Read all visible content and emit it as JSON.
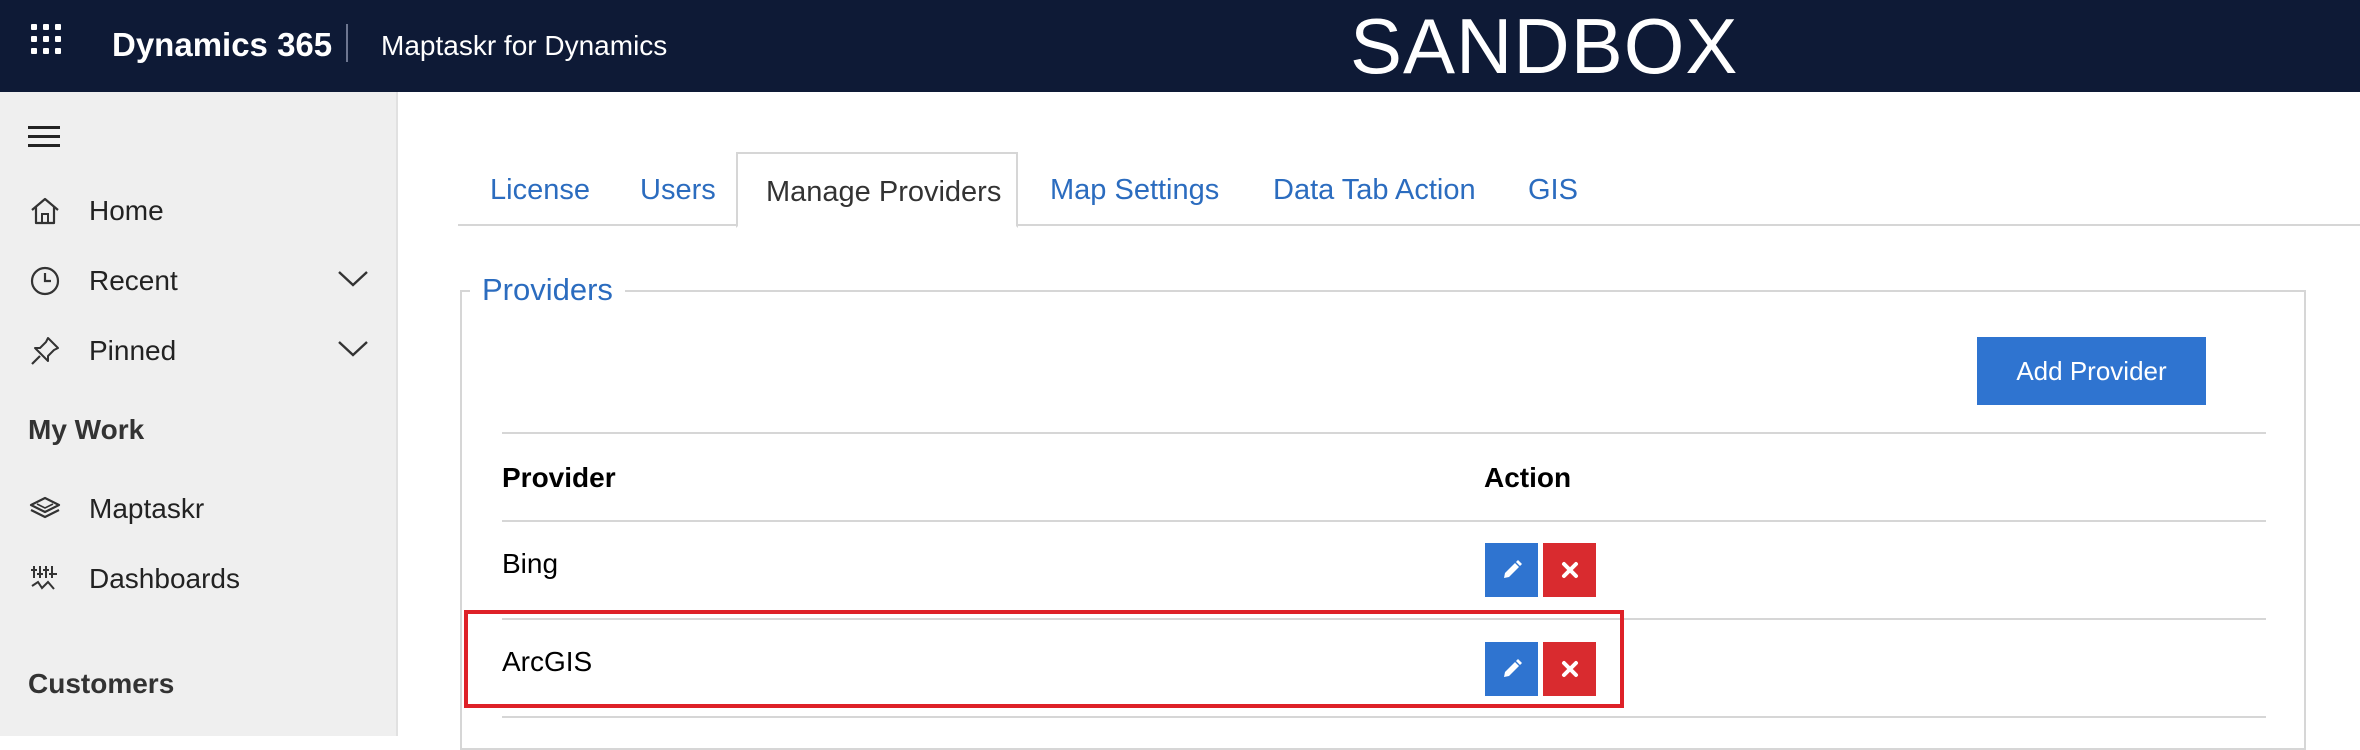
{
  "header": {
    "brand": "Dynamics 365",
    "app_name": "Maptaskr for Dynamics",
    "environment_label": "SANDBOX",
    "background_color": "#0e1a36"
  },
  "sidebar": {
    "items": [
      {
        "label": "Home",
        "icon": "home-icon"
      },
      {
        "label": "Recent",
        "icon": "clock-icon",
        "expandable": true
      },
      {
        "label": "Pinned",
        "icon": "pin-icon",
        "expandable": true
      }
    ],
    "section_my_work": "My Work",
    "work_items": [
      {
        "label": "Maptaskr",
        "icon": "layers-icon"
      },
      {
        "label": "Dashboards",
        "icon": "dashboard-icon"
      }
    ],
    "section_customers": "Customers"
  },
  "tabs": [
    {
      "label": "License",
      "active": false
    },
    {
      "label": "Users",
      "active": false
    },
    {
      "label": "Manage Providers",
      "active": true
    },
    {
      "label": "Map Settings",
      "active": false
    },
    {
      "label": "Data Tab Action",
      "active": false
    },
    {
      "label": "GIS",
      "active": false
    }
  ],
  "providers": {
    "legend": "Providers",
    "add_button": "Add Provider",
    "columns": [
      "Provider",
      "Action"
    ],
    "rows": [
      {
        "name": "Bing"
      },
      {
        "name": "ArcGIS",
        "highlighted": true
      }
    ]
  },
  "colors": {
    "accent": "#2f74d0",
    "delete": "#d92b2f",
    "highlight": "#de2128",
    "link": "#2b6cbf"
  }
}
